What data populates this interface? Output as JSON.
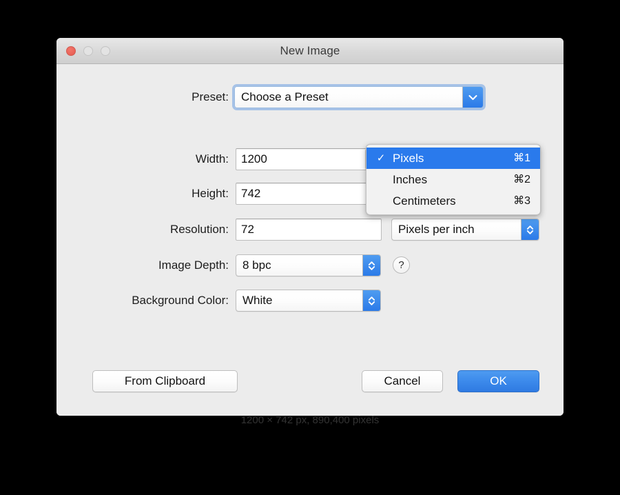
{
  "window": {
    "title": "New Image",
    "traffic_lights": {
      "close": "close-button",
      "minimize": "minimize-button",
      "zoom": "zoom-button"
    }
  },
  "form": {
    "preset": {
      "label": "Preset:",
      "value": "Choose a Preset",
      "icon": "chevron-down-icon"
    },
    "width": {
      "label": "Width:",
      "value": "1200",
      "placeholder": "Width"
    },
    "height": {
      "label": "Height:",
      "value": "742",
      "placeholder": "Height"
    },
    "resolution": {
      "label": "Resolution:",
      "value": "72",
      "placeholder": "Resolution"
    },
    "resolution_unit": {
      "value": "Pixels per inch",
      "icon": "chevron-up-down-icon"
    },
    "image_depth": {
      "label": "Image Depth:",
      "value": "8 bpc",
      "icon": "chevron-up-down-icon"
    },
    "background_color": {
      "label": "Background Color:",
      "value": "White",
      "icon": "chevron-up-down-icon"
    },
    "help": {
      "label": "?"
    }
  },
  "units_menu": {
    "items": [
      {
        "label": "Pixels",
        "shortcut": "⌘1",
        "checked": true,
        "check_glyph": "✓"
      },
      {
        "label": "Inches",
        "shortcut": "⌘2",
        "checked": false,
        "check_glyph": ""
      },
      {
        "label": "Centimeters",
        "shortcut": "⌘3",
        "checked": false,
        "check_glyph": ""
      }
    ]
  },
  "buttons": {
    "from_clipboard": "From Clipboard",
    "cancel": "Cancel",
    "ok": "OK"
  },
  "status": {
    "text": "1200 × 742 px, 890,400 pixels"
  },
  "colors": {
    "accent_blue": "#2f7ae2",
    "menu_highlight": "#2a7aec",
    "window_bg": "#ececec",
    "titlebar_top": "#e8e8e8",
    "close_red": "#ea6258"
  }
}
